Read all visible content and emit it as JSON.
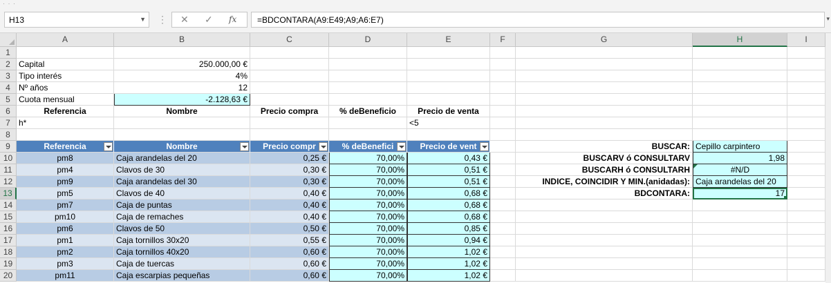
{
  "formula_bar": {
    "name_box": "H13",
    "cancel_icon": "✕",
    "enter_icon": "✓",
    "fx_icon": "fx",
    "formula": "=BDCONTARA(A9:E49;A9;A6:E7)"
  },
  "columns": [
    "A",
    "B",
    "C",
    "D",
    "E",
    "F",
    "G",
    "H",
    "I"
  ],
  "rows": [
    "1",
    "2",
    "3",
    "4",
    "5",
    "6",
    "7",
    "8",
    "9",
    "10",
    "11",
    "12",
    "13",
    "14",
    "15",
    "16",
    "17",
    "18",
    "19",
    "20"
  ],
  "params": {
    "capital_label": "Capital",
    "capital_value": "250.000,00 €",
    "rate_label": "Tipo interés",
    "rate_value": "4%",
    "years_label": "Nº años",
    "years_value": "12",
    "payment_label": "Cuota mensual",
    "payment_value": "-2.128,63 €"
  },
  "criteria": {
    "headers": [
      "Referencia",
      "Nombre",
      "Precio compra",
      "% deBeneficio",
      "Precio de venta"
    ],
    "values": [
      "h*",
      "",
      "",
      "",
      "<5"
    ]
  },
  "table": {
    "headers": [
      "Referencia",
      "Nombre",
      "Precio compr",
      "% deBenefici",
      "Precio de vent"
    ],
    "rows": [
      [
        "pm8",
        "Caja arandelas del 20",
        "0,25 €",
        "70,00%",
        "0,43 €"
      ],
      [
        "pm4",
        "Clavos de 30",
        "0,30 €",
        "70,00%",
        "0,51 €"
      ],
      [
        "pm9",
        "Caja arandelas del 30",
        "0,30 €",
        "70,00%",
        "0,51 €"
      ],
      [
        "pm5",
        "Clavos de 40",
        "0,40 €",
        "70,00%",
        "0,68 €"
      ],
      [
        "pm7",
        "Caja de puntas",
        "0,40 €",
        "70,00%",
        "0,68 €"
      ],
      [
        "pm10",
        "Caja de remaches",
        "0,40 €",
        "70,00%",
        "0,68 €"
      ],
      [
        "pm6",
        "Clavos de 50",
        "0,50 €",
        "70,00%",
        "0,85 €"
      ],
      [
        "pm1",
        "Caja tornillos 30x20",
        "0,55 €",
        "70,00%",
        "0,94 €"
      ],
      [
        "pm2",
        "Caja tornillos 40x20",
        "0,60 €",
        "70,00%",
        "1,02 €"
      ],
      [
        "pm3",
        "Caja de tuercas",
        "0,60 €",
        "70,00%",
        "1,02 €"
      ],
      [
        "pm11",
        "Caja escarpias pequeñas",
        "0,60 €",
        "70,00%",
        "1,02 €"
      ]
    ]
  },
  "lookup": {
    "items": [
      {
        "label": "BUSCAR:",
        "value": "Cepillo carpintero"
      },
      {
        "label": "BUSCARV ó CONSULTARV",
        "value": "1,98"
      },
      {
        "label": "BUSCARH ó  CONSULTARH",
        "value": "#N/D"
      },
      {
        "label": "INDICE, COINCIDIR Y MIN.(anidadas):",
        "value": "Caja arandelas del 20"
      },
      {
        "label": "BDCONTARA:",
        "value": "17"
      }
    ]
  }
}
